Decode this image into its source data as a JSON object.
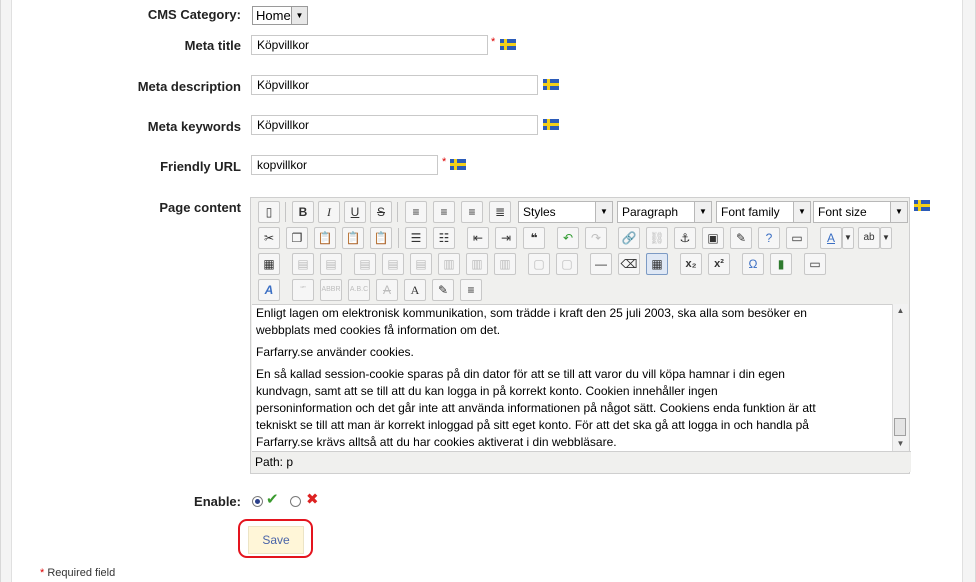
{
  "form": {
    "cms_category": {
      "label": "CMS Category:",
      "value": "Home"
    },
    "meta_title": {
      "label": "Meta title",
      "value": "Köpvillkor",
      "required_mark": "*"
    },
    "meta_description": {
      "label": "Meta description",
      "value": "Köpvillkor"
    },
    "meta_keywords": {
      "label": "Meta keywords",
      "value": "Köpvillkor"
    },
    "friendly_url": {
      "label": "Friendly URL",
      "value": "kopvillkor",
      "required_mark": "*"
    },
    "page_content": {
      "label": "Page content"
    },
    "enable": {
      "label": "Enable:",
      "selected": "yes"
    },
    "save_label": "Save",
    "footer_required_mark": "*",
    "footer_required_text": "Required field"
  },
  "editor": {
    "dropdowns": {
      "styles": "Styles",
      "format": "Paragraph",
      "font_family": "Font family",
      "font_size": "Font size"
    },
    "paragraphs": [
      "Enligt lagen om elektronisk kommunikation, som trädde i kraft den 25 juli 2003, ska alla som besöker en webbplats med cookies få information om det.",
      "Farfarry.se använder cookies.",
      "En så kallad session-cookie sparas på din dator för att se till att varor du vill köpa hamnar i din egen kundvagn, samt att se till att du kan logga in på korrekt konto. Cookien innehåller ingen personinformation och det går inte att använda informationen på något sätt. Cookiens enda funktion är att tekniskt se till att man är korrekt inloggad på sitt eget konto. För att det ska gå att logga in och handla på Farfarry.se krävs alltså att du har cookies aktiverat i din webbläsare."
    ],
    "path": "Path: p"
  },
  "colors": {
    "flag_blue": "#2b5bb8",
    "flag_yellow": "#f2cf1a",
    "highlight_red": "#e4141e",
    "save_bg": "#fff6d8"
  },
  "icons": {
    "language_flag": "swedish-flag-icon",
    "enable_yes": "green-check-icon",
    "enable_no": "red-cross-icon"
  }
}
